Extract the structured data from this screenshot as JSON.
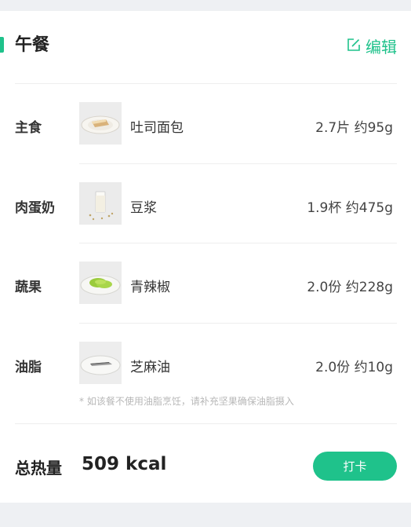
{
  "meal": {
    "title": "午餐",
    "edit_label": "编辑"
  },
  "items": [
    {
      "category": "主食",
      "food": "吐司面包",
      "amount": "2.7片 约95g",
      "icon": "toast-bread-icon"
    },
    {
      "category": "肉蛋奶",
      "food": "豆浆",
      "amount": "1.9杯 约475g",
      "icon": "soy-milk-icon"
    },
    {
      "category": "蔬果",
      "food": "青辣椒",
      "amount": "2.0份 约228g",
      "icon": "green-pepper-icon"
    },
    {
      "category": "油脂",
      "food": "芝麻油",
      "amount": "2.0份 约10g",
      "icon": "sesame-oil-icon"
    }
  ],
  "note": "* 如该餐不使用油脂烹饪，请补充坚果确保油脂摄入",
  "total": {
    "label": "总热量",
    "value": "509 kcal"
  },
  "checkin_label": "打卡",
  "colors": {
    "accent": "#1fc28b",
    "background": "#eef0f3"
  }
}
